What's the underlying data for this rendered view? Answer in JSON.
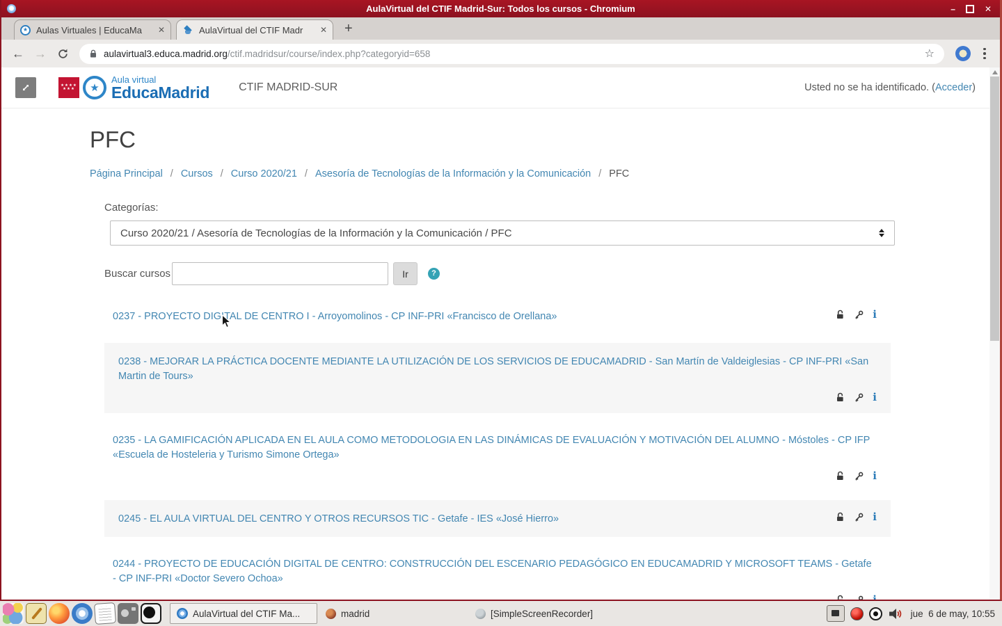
{
  "window": {
    "title": "AulaVirtual del CTIF Madrid-Sur: Todos los cursos - Chromium",
    "controls": {
      "minimize": "–",
      "close": "✕"
    }
  },
  "browser": {
    "tabs": [
      {
        "label": "Aulas Virtuales | EducaMa",
        "active": false
      },
      {
        "label": "AulaVirtual del CTIF Madr",
        "active": true
      }
    ],
    "new_tab": "+",
    "url": {
      "host": "aulavirtual3.educa.madrid.org",
      "path": "/ctif.madridsur/course/index.php?categoryid=658"
    }
  },
  "site_header": {
    "brand_top": "Aula virtual",
    "brand_name": "EducaMadrid",
    "site_name": "CTIF MADRID-SUR",
    "login_prefix": "Usted no se ha identificado. (",
    "login_link": "Acceder",
    "login_suffix": ")"
  },
  "page": {
    "title": "PFC",
    "breadcrumb": [
      {
        "label": "Página Principal",
        "link": true
      },
      {
        "label": "Cursos",
        "link": true
      },
      {
        "label": "Curso 2020/21",
        "link": true
      },
      {
        "label": "Asesoría de Tecnologías de la Información y la Comunicación",
        "link": true
      },
      {
        "label": "PFC",
        "link": false
      }
    ],
    "categories": {
      "label": "Categorías:",
      "selected": "Curso 2020/21 / Asesoría de Tecnologías de la Información y la Comunicación / PFC"
    },
    "search": {
      "label": "Buscar cursos",
      "value": "",
      "go": "Ir",
      "help": "?"
    },
    "courses": [
      {
        "title": "0237 - PROYECTO DIGITAL DE CENTRO I - Arroyomolinos - CP INF-PRI «Francisco de Orellana»"
      },
      {
        "title": "0238 - MEJORAR LA PRÁCTICA DOCENTE MEDIANTE LA UTILIZACIÓN DE LOS SERVICIOS DE EDUCAMADRID - San Martín de Valdeiglesias - CP INF-PRI «San Martin de Tours»"
      },
      {
        "title": "0235 - LA GAMIFICACIÓN APLICADA EN EL AULA COMO METODOLOGIA EN LAS DINÁMICAS DE EVALUACIÓN Y MOTIVACIÓN DEL ALUMNO - Móstoles - CP IFP «Escuela de Hosteleria y Turismo Simone Ortega»"
      },
      {
        "title": "0245 - EL AULA VIRTUAL DEL CENTRO Y OTROS RECURSOS TIC - Getafe - IES «José Hierro»"
      },
      {
        "title": "0244 - PROYECTO DE EDUCACIÓN DIGITAL DE CENTRO: CONSTRUCCIÓN DEL ESCENARIO PEDAGÓGICO EN EDUCAMADRID Y MICROSOFT TEAMS - Getafe - CP INF-PRI «Doctor Severo Ochoa»"
      }
    ]
  },
  "taskbar": {
    "windows": [
      {
        "label": "AulaVirtual del CTIF Ma...",
        "active": true
      },
      {
        "label": "madrid",
        "active": false
      },
      {
        "label": "[SimpleScreenRecorder]",
        "active": false
      }
    ],
    "clock": "jue  6 de may, 10:55"
  },
  "colors": {
    "titlebar_red": "#9a1420",
    "madrid_flag_red": "#c31432",
    "brand_blue": "#1a6db4",
    "link_blue": "#4387b2",
    "help_teal": "#35a3b5",
    "info_blue": "#2d7cb8"
  }
}
